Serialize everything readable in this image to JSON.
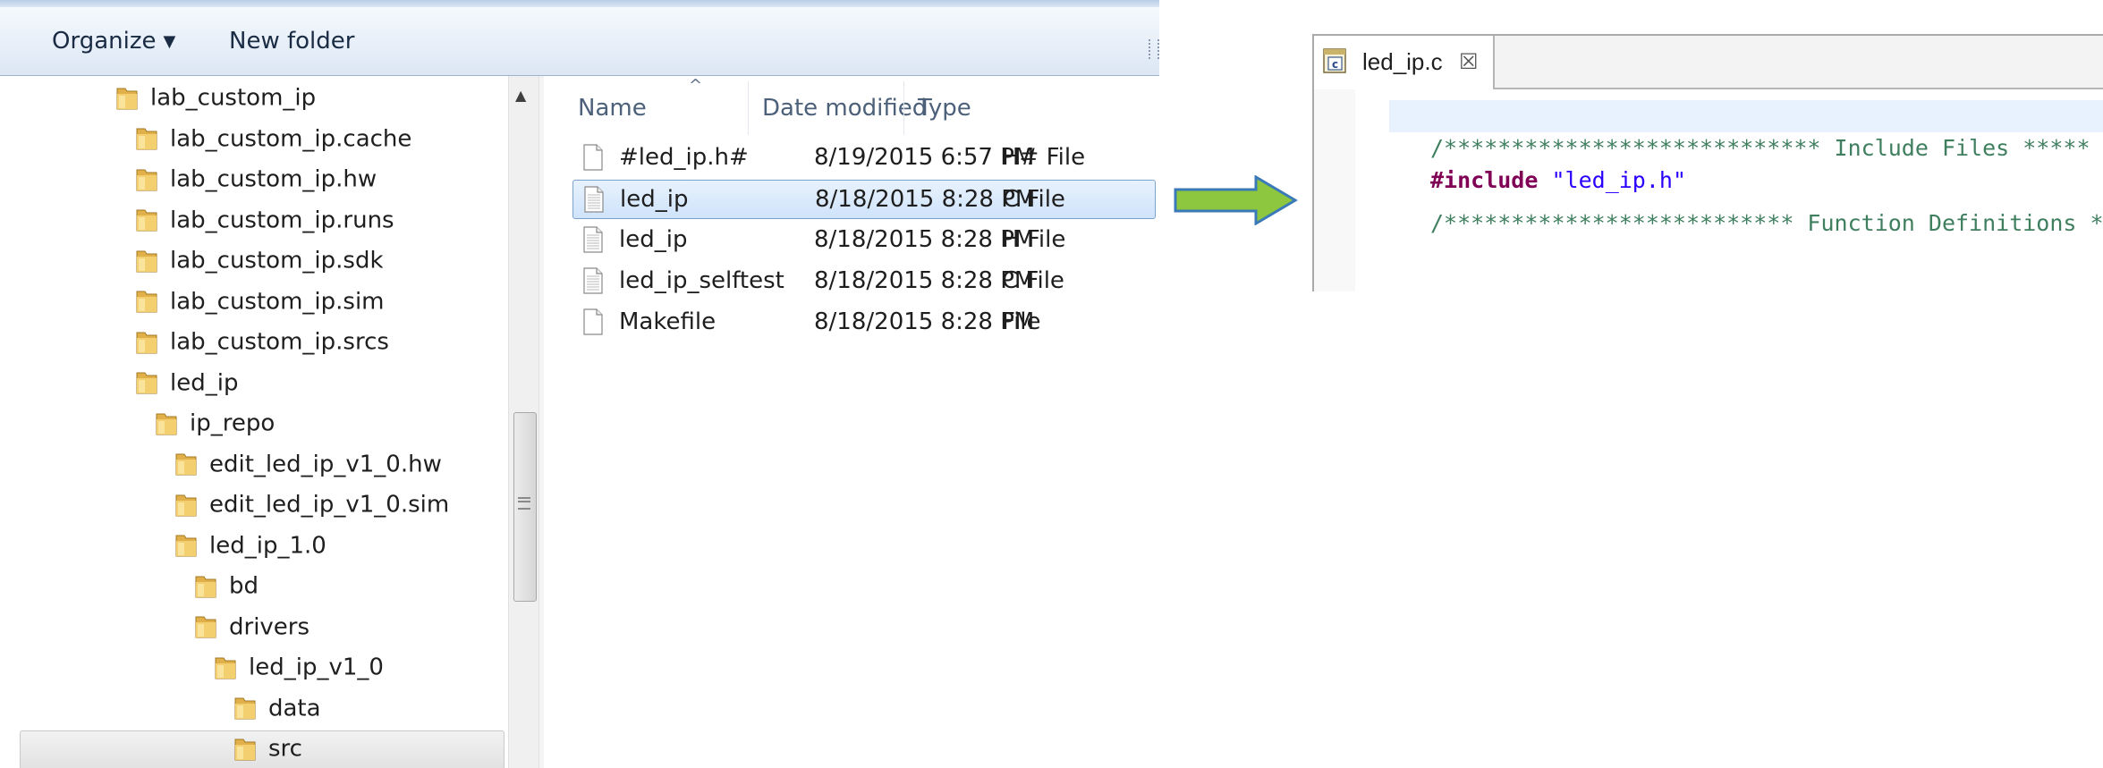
{
  "explorer": {
    "toolbar": {
      "organize": "Organize",
      "new_folder": "New folder"
    },
    "tree": [
      {
        "label": "lab_custom_ip"
      },
      {
        "label": "lab_custom_ip.cache"
      },
      {
        "label": "lab_custom_ip.hw"
      },
      {
        "label": "lab_custom_ip.runs"
      },
      {
        "label": "lab_custom_ip.sdk"
      },
      {
        "label": "lab_custom_ip.sim"
      },
      {
        "label": "lab_custom_ip.srcs"
      },
      {
        "label": "led_ip"
      },
      {
        "label": "ip_repo"
      },
      {
        "label": "edit_led_ip_v1_0.hw"
      },
      {
        "label": "edit_led_ip_v1_0.sim"
      },
      {
        "label": "led_ip_1.0"
      },
      {
        "label": "bd"
      },
      {
        "label": "drivers"
      },
      {
        "label": "led_ip_v1_0"
      },
      {
        "label": "data"
      },
      {
        "label": "src"
      }
    ],
    "selected_folder": "src",
    "columns": {
      "name": "Name",
      "date": "Date modified",
      "type": "Type"
    },
    "files": [
      {
        "name": "#led_ip.h#",
        "date": "8/19/2015 6:57 PM",
        "type": "H# File",
        "icon": "blank-file-icon"
      },
      {
        "name": "led_ip",
        "date": "8/18/2015 8:28 PM",
        "type": "C File",
        "icon": "text-file-icon",
        "selected": true
      },
      {
        "name": "led_ip",
        "date": "8/18/2015 8:28 PM",
        "type": "H File",
        "icon": "text-file-icon"
      },
      {
        "name": "led_ip_selftest",
        "date": "8/18/2015 8:28 PM",
        "type": "C File",
        "icon": "text-file-icon"
      },
      {
        "name": "Makefile",
        "date": "8/18/2015 8:28 PM",
        "type": "File",
        "icon": "blank-file-icon"
      }
    ]
  },
  "editor": {
    "tab": {
      "title": "led_ip.c",
      "close_glyph": "☒",
      "icon": "c-source-file-icon"
    },
    "code": {
      "line1": "/**************************** Include Files *****",
      "line2_keyword": "#include",
      "line2_string": "\"led_ip.h\"",
      "line3": "/************************** Function Definitions *"
    }
  },
  "colors": {
    "arrow_fill": "#8dc63f",
    "arrow_stroke": "#3b7ab8",
    "comment": "#3f7f5f",
    "keyword": "#7f0055",
    "string": "#2a00ff",
    "selection": "#cfe3fb"
  }
}
